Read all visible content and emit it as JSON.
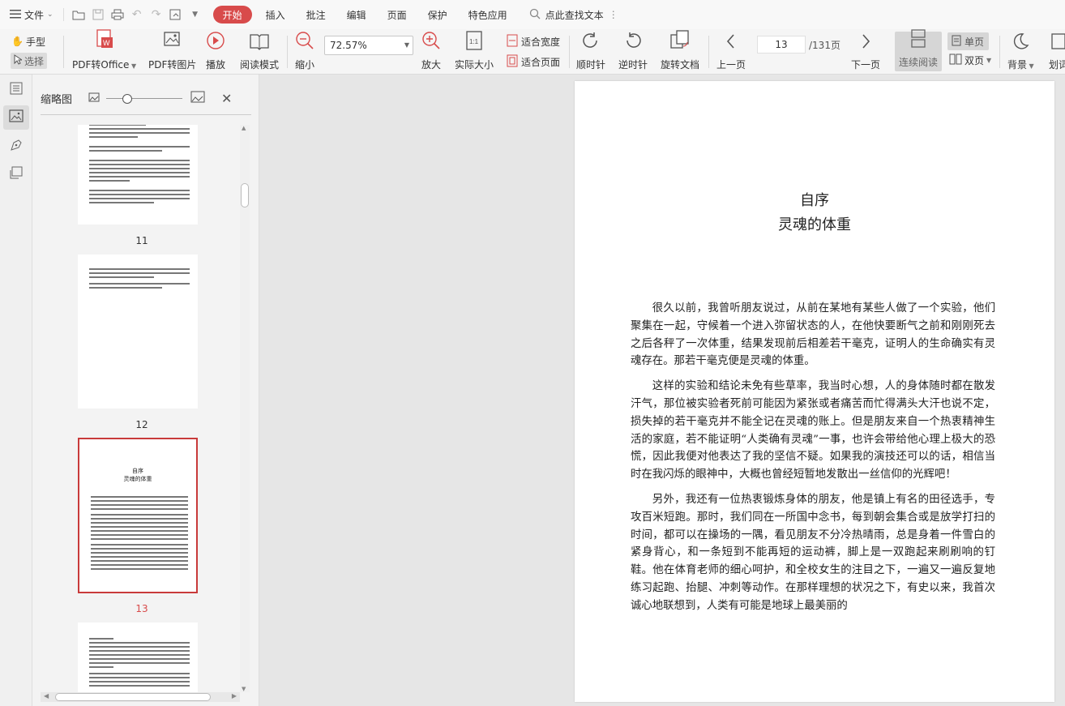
{
  "menubar": {
    "file_label": "文件",
    "tabs": [
      {
        "label": "开始",
        "active": true
      },
      {
        "label": "插入"
      },
      {
        "label": "批注"
      },
      {
        "label": "编辑"
      },
      {
        "label": "页面"
      },
      {
        "label": "保护"
      },
      {
        "label": "特色应用"
      }
    ],
    "search_label": "点此查找文本"
  },
  "toolbar": {
    "hand_label": "手型",
    "select_label": "选择",
    "pdf_to_office": "PDF转Office",
    "pdf_to_image": "PDF转图片",
    "play": "播放",
    "read_mode": "阅读模式",
    "zoom_out": "缩小",
    "zoom_value": "72.57%",
    "zoom_in": "放大",
    "actual_size": "实际大小",
    "fit_width": "适合宽度",
    "fit_page": "适合页面",
    "rotate_cw": "顺时针",
    "rotate_ccw": "逆时针",
    "rotate_doc": "旋转文档",
    "prev_page": "上一页",
    "current_page": "13",
    "total_pages": "/131页",
    "next_page": "下一页",
    "continuous": "连续阅读",
    "single": "单页",
    "double": "双页",
    "background": "背景",
    "more": "划词"
  },
  "thumbnails": {
    "title": "缩略图",
    "pages": [
      {
        "label": "11"
      },
      {
        "label": "12"
      },
      {
        "label": "13",
        "selected": true
      },
      {
        "label": ""
      }
    ],
    "thumb13_title": "自序",
    "thumb13_subtitle": "灵魂的体重"
  },
  "document": {
    "title": "自序",
    "subtitle": "灵魂的体重",
    "paragraphs": [
      "很久以前，我曾听朋友说过，从前在某地有某些人做了一个实验，他们聚集在一起，守候着一个进入弥留状态的人，在他快要断气之前和刚刚死去之后各秤了一次体重，结果发现前后相差若干毫克，证明人的生命确实有灵魂存在。那若干毫克便是灵魂的体重。",
      "这样的实验和结论未免有些草率，我当时心想，人的身体随时都在散发汗气，那位被实验者死前可能因为紧张或者痛苦而忙得满头大汗也说不定，损失掉的若干毫克并不能全记在灵魂的账上。但是朋友来自一个热衷精神生活的家庭，若不能证明“人类确有灵魂”一事，也许会带给他心理上极大的恐慌，因此我便对他表达了我的坚信不疑。如果我的演技还可以的话，相信当时在我闪烁的眼神中，大概也曾经短暂地发散出一丝信仰的光辉吧！",
      "另外，我还有一位热衷锻炼身体的朋友，他是镇上有名的田径选手，专攻百米短跑。那时，我们同在一所国中念书，每到朝会集合或是放学打扫的时间，都可以在操场的一隅，看见朋友不分冷热晴雨，总是身着一件雪白的紧身背心，和一条短到不能再短的运动裤，脚上是一双跑起来刷刷响的钉鞋。他在体育老师的细心呵护，和全校女生的注目之下，一遍又一遍反复地练习起跑、抬腿、冲刺等动作。在那样理想的状况之下，有史以来，我首次诚心地联想到，人类有可能是地球上最美丽的"
    ]
  },
  "colors": {
    "accent": "#d84b4b",
    "toolbar_bg": "#f5f5f5",
    "viewer_bg": "#e6e6e6"
  }
}
